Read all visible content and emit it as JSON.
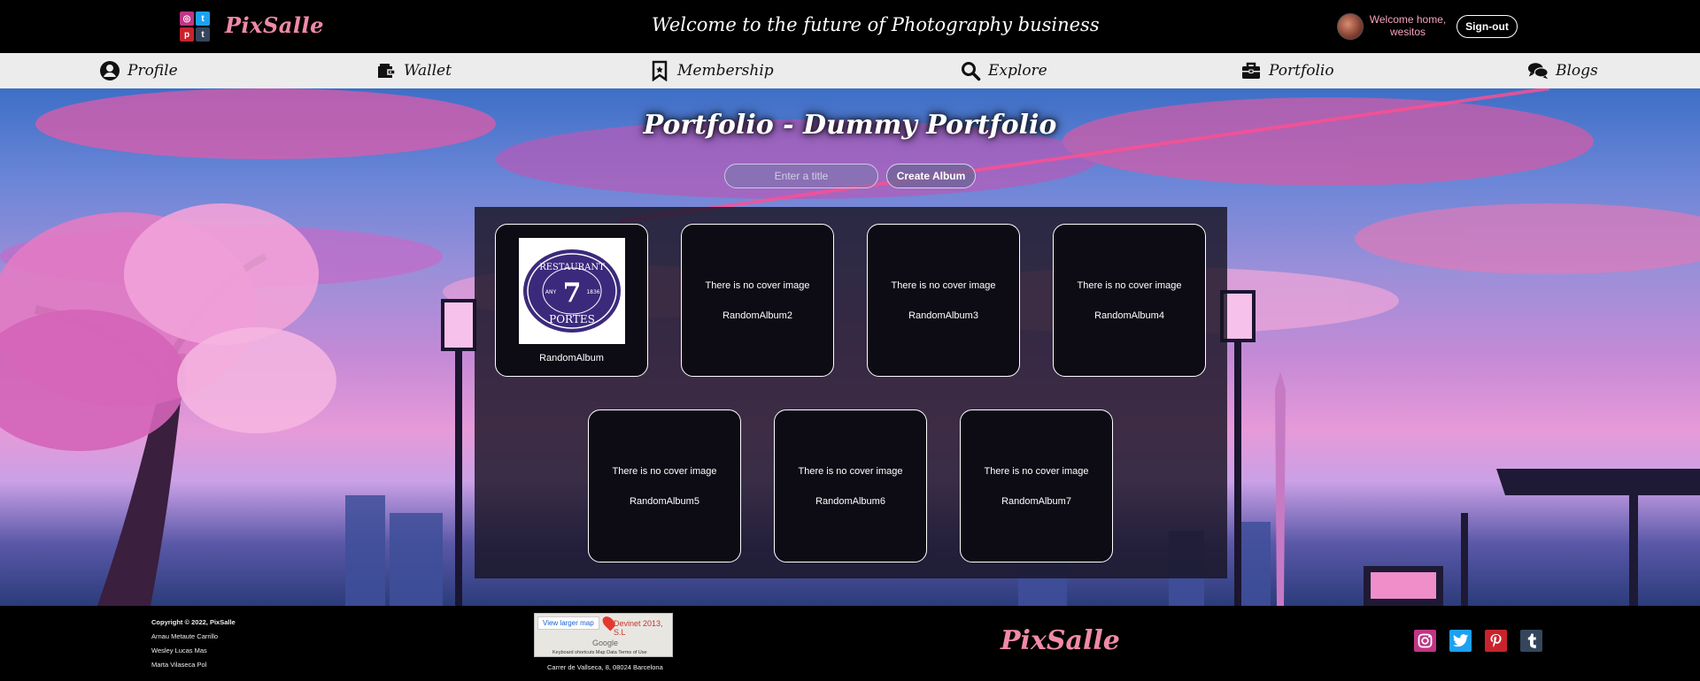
{
  "header": {
    "brand": "PixSalle",
    "tagline": "Welcome to the future of Photography business",
    "welcome_line1": "Welcome home,",
    "welcome_line2": "wesitos",
    "signout_label": "Sign-out",
    "social_icons": [
      "instagram-icon",
      "twitter-icon",
      "pinterest-icon",
      "tumblr-icon"
    ]
  },
  "nav": {
    "items": [
      {
        "label": "Profile",
        "icon": "user-icon"
      },
      {
        "label": "Wallet",
        "icon": "wallet-icon"
      },
      {
        "label": "Membership",
        "icon": "bookmark-icon"
      },
      {
        "label": "Explore",
        "icon": "search-icon"
      },
      {
        "label": "Portfolio",
        "icon": "briefcase-icon"
      },
      {
        "label": "Blogs",
        "icon": "comments-icon"
      }
    ]
  },
  "main": {
    "title": "Portfolio - Dummy Portfolio",
    "title_placeholder": "Enter a title",
    "create_label": "Create Album",
    "no_cover_text": "There is no cover image",
    "albums": [
      {
        "name": "RandomAlbum",
        "has_cover": true,
        "cover_text": {
          "top": "RESTAURANT",
          "number": "7",
          "left": "ANY",
          "right": "1836",
          "bottom": "PORTES"
        }
      },
      {
        "name": "RandomAlbum2",
        "has_cover": false
      },
      {
        "name": "RandomAlbum3",
        "has_cover": false
      },
      {
        "name": "RandomAlbum4",
        "has_cover": false
      },
      {
        "name": "RandomAlbum5",
        "has_cover": false
      },
      {
        "name": "RandomAlbum6",
        "has_cover": false
      },
      {
        "name": "RandomAlbum7",
        "has_cover": false
      }
    ]
  },
  "footer": {
    "copyright": "Copyright © 2022, PixSalle",
    "authors": [
      "Arnau Metaute Carrillo",
      "Wesley Lucas Mas",
      "Marta Vilaseca Pol"
    ],
    "map": {
      "link_label": "View larger map",
      "pin_label": "Devinet 2013, S.L",
      "provider": "Google",
      "terms": "Keyboard shortcuts    Map Data    Terms of Use"
    },
    "address": "Carrer de Vallseca, 8, 08024 Barcelona",
    "brand": "PixSalle",
    "social_icons": [
      "instagram-icon",
      "twitter-icon",
      "pinterest-icon",
      "tumblr-icon"
    ]
  },
  "colors": {
    "brand_pink": "#f08aa6",
    "instagram": "#c13584",
    "twitter": "#1da1f2",
    "pinterest": "#c8232c",
    "tumblr": "#35465c"
  }
}
